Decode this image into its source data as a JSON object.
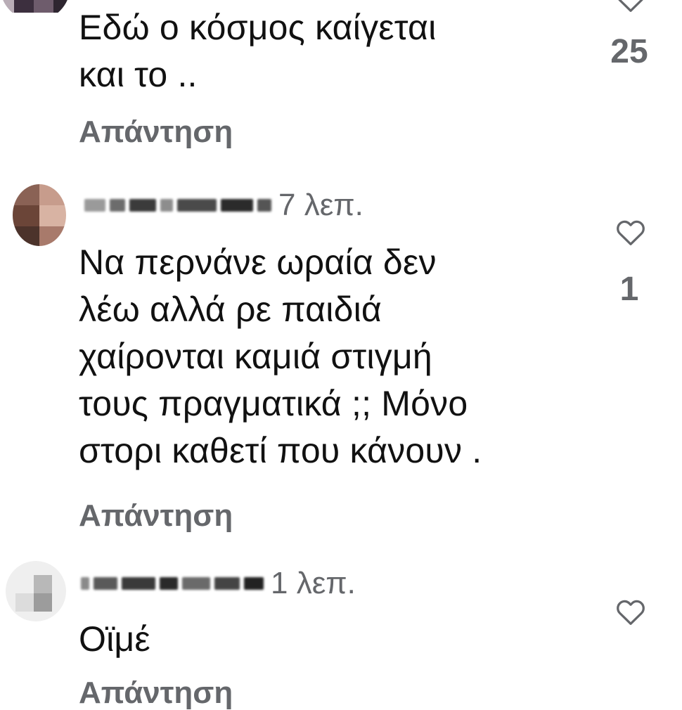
{
  "comments": [
    {
      "text": "Εδώ ο κόσμος καίγεται\nκαι το ..",
      "reply_label": "Απάντηση",
      "likes": "25"
    },
    {
      "time": "7 λεπ.",
      "text": "Να περνάνε ωραία δεν\nλέω αλλά ρε παιδιά\nχαίρονται καμιά στιγμή\nτους πραγματικά ;; Μόνο\nστορι καθετί που κάνουν .",
      "reply_label": "Απάντηση",
      "likes": "1"
    },
    {
      "time": "1 λεπ.",
      "text": "Οϊμέ",
      "reply_label": "Απάντηση"
    }
  ],
  "icons": {
    "like": "heart-outline-icon"
  },
  "colors": {
    "text": "#111111",
    "secondary": "#65676b",
    "background": "#ffffff"
  }
}
